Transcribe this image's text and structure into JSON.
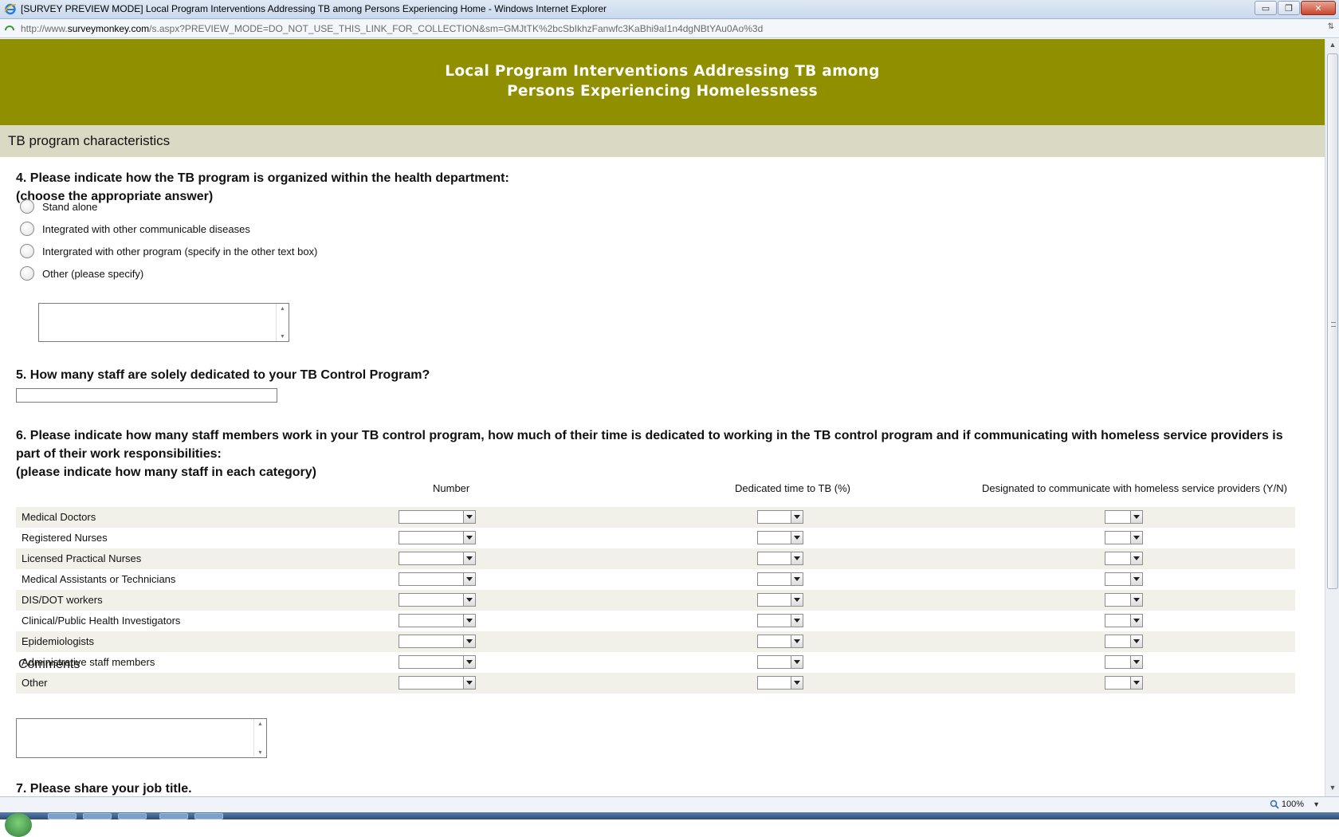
{
  "window": {
    "title": "[SURVEY PREVIEW MODE] Local Program Interventions Addressing TB among Persons Experiencing Home - Windows Internet Explorer",
    "minimize_label": "▭",
    "restore_label": "❐",
    "close_label": "✕"
  },
  "address": {
    "url_prefix": "http://www.",
    "url_domain": "surveymonkey.com",
    "url_rest": "/s.aspx?PREVIEW_MODE=DO_NOT_USE_THIS_LINK_FOR_COLLECTION&sm=GMJtTK%2bcSbIkhzFanwfc3KaBhi9aI1n4dgNBtYAu0Ao%3d"
  },
  "survey": {
    "title_line1": "Local Program Interventions Addressing TB among",
    "title_line2": "Persons Experiencing Homelessness",
    "section": "TB program characteristics",
    "q4": {
      "line1": "4. Please indicate how the TB program is organized within the health department:",
      "line2": "(choose the appropriate answer)",
      "options": [
        "Stand alone",
        "Integrated with other communicable diseases",
        "Intergrated with other program (specify in the other text box)",
        "Other (please specify)"
      ]
    },
    "q5": {
      "text": "5. How many staff are solely dedicated to your TB Control Program?"
    },
    "q6": {
      "line1": "6. Please indicate how many staff members work in your TB control program, how much of their time is dedicated to working in the TB control program and if communicating with homeless service providers is",
      "line2": "part of their work responsibilities:",
      "line3": "(please indicate how many staff in each category)",
      "columns": [
        "Number",
        "Dedicated time to TB (%)",
        "Designated to communicate with homeless service providers (Y/N)"
      ],
      "rows": [
        "Medical Doctors",
        "Registered Nurses",
        "Licensed Practical Nurses",
        "Medical Assistants or Technicians",
        "DIS/DOT workers",
        "Clinical/Public Health Investigators",
        "Epidemiologists",
        "Administrative staff members",
        "Other"
      ],
      "comments_label": "Comments"
    },
    "q7": {
      "text": "7. Please share your job title."
    }
  },
  "status": {
    "zoom": "100%"
  },
  "colors": {
    "banner": "#8f8f00",
    "section_bg": "#d9d9c4",
    "row_alt": "#f1f1e9"
  }
}
